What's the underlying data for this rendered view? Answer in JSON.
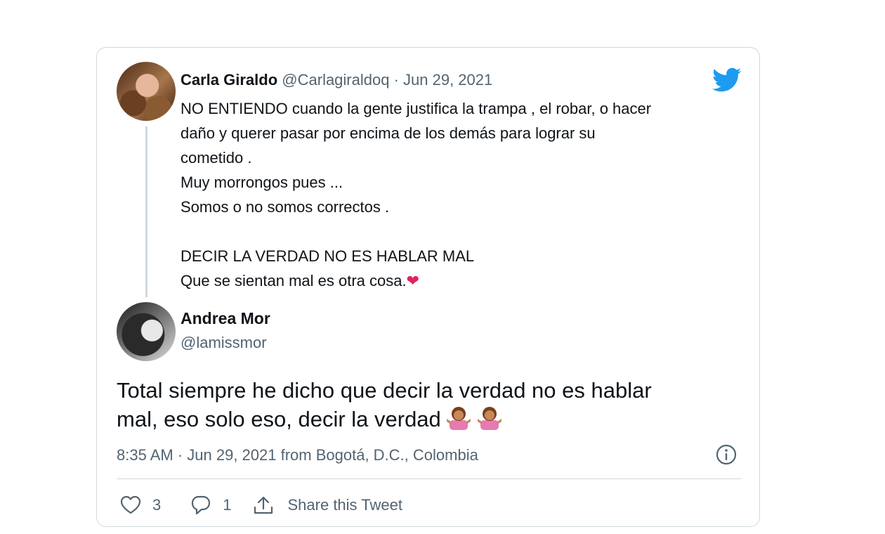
{
  "quoted_tweet": {
    "author_name": "Carla Giraldo",
    "handle_and_date": "@Carlagiraldoq · Jun 29, 2021",
    "lines": [
      "NO ENTIENDO  cuando la gente justifica la trampa , el robar, o hacer",
      "daño y querer pasar por encima  de los demás para lograr su",
      "cometido .",
      "Muy morrongos pues ...",
      "Somos o no somos correctos .",
      "",
      "DECIR LA VERDAD NO ES HABLAR MAL",
      "Que se sientan mal es otra cosa."
    ],
    "end_emoji": "❤"
  },
  "tweet": {
    "author_name": "Andrea Mor",
    "author_handle": "@lamissmor",
    "text_line1": "Total siempre he dicho que decir la verdad no es hablar",
    "text_line2": "mal, eso solo eso, decir la verdad",
    "emojis": [
      "person-shrugging-icon",
      "person-shrugging-icon"
    ],
    "meta": "8:35 AM · Jun 29, 2021 from Bogotá, D.C., Colombia"
  },
  "actions": {
    "like_count": "3",
    "reply_count": "1",
    "share_label": "Share this Tweet"
  },
  "colors": {
    "twitter_blue": "#1d9bf0",
    "secondary_text": "#536471",
    "border": "#cfd9de",
    "heart": "#e0245e"
  }
}
